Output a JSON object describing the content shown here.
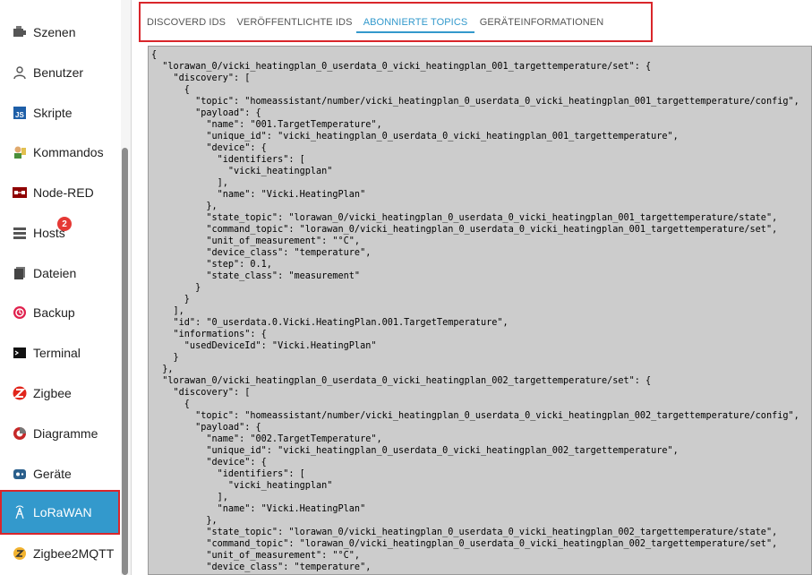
{
  "sidebar": {
    "items": [
      {
        "label": "Szenen",
        "icon": "scenes-icon"
      },
      {
        "label": "Benutzer",
        "icon": "user-icon"
      },
      {
        "label": "Skripte",
        "icon": "javascript-icon"
      },
      {
        "label": "Kommandos",
        "icon": "commands-icon"
      },
      {
        "label": "Node-RED",
        "icon": "node-red-icon"
      },
      {
        "label": "Hosts",
        "icon": "hosts-icon",
        "badge": "2"
      },
      {
        "label": "Dateien",
        "icon": "files-icon"
      },
      {
        "label": "Backup",
        "icon": "backup-icon"
      },
      {
        "label": "Terminal",
        "icon": "terminal-icon"
      },
      {
        "label": "Zigbee",
        "icon": "zigbee-icon"
      },
      {
        "label": "Diagramme",
        "icon": "diagrams-icon"
      },
      {
        "label": "Geräte",
        "icon": "devices-icon"
      },
      {
        "label": "LoRaWAN",
        "icon": "lorawan-icon",
        "active": true
      },
      {
        "label": "Zigbee2MQTT",
        "icon": "zigbee2mqtt-icon"
      }
    ]
  },
  "tabs": [
    {
      "label": "DISCOVERD IDS"
    },
    {
      "label": "VERÖFFENTLICHTE IDS"
    },
    {
      "label": "ABONNIERTE TOPICS",
      "active": true
    },
    {
      "label": "GERÄTEINFORMATIONEN"
    }
  ],
  "code": {
    "lines": [
      "{",
      "  \"lorawan_0/vicki_heatingplan_0_userdata_0_vicki_heatingplan_001_targettemperature/set\": {",
      "    \"discovery\": [",
      "      {",
      "        \"topic\": \"homeassistant/number/vicki_heatingplan_0_userdata_0_vicki_heatingplan_001_targettemperature/config\",",
      "        \"payload\": {",
      "          \"name\": \"001.TargetTemperature\",",
      "          \"unique_id\": \"vicki_heatingplan_0_userdata_0_vicki_heatingplan_001_targettemperature\",",
      "          \"device\": {",
      "            \"identifiers\": [",
      "              \"vicki_heatingplan\"",
      "            ],",
      "            \"name\": \"Vicki.HeatingPlan\"",
      "          },",
      "          \"state_topic\": \"lorawan_0/vicki_heatingplan_0_userdata_0_vicki_heatingplan_001_targettemperature/state\",",
      "          \"command_topic\": \"lorawan_0/vicki_heatingplan_0_userdata_0_vicki_heatingplan_001_targettemperature/set\",",
      "          \"unit_of_measurement\": \"°C\",",
      "          \"device_class\": \"temperature\",",
      "          \"step\": 0.1,",
      "          \"state_class\": \"measurement\"",
      "        }",
      "      }",
      "    ],",
      "    \"id\": \"0_userdata.0.Vicki.HeatingPlan.001.TargetTemperature\",",
      "    \"informations\": {",
      "      \"usedDeviceId\": \"Vicki.HeatingPlan\"",
      "    }",
      "  },",
      "  \"lorawan_0/vicki_heatingplan_0_userdata_0_vicki_heatingplan_002_targettemperature/set\": {",
      "    \"discovery\": [",
      "      {",
      "        \"topic\": \"homeassistant/number/vicki_heatingplan_0_userdata_0_vicki_heatingplan_002_targettemperature/config\",",
      "        \"payload\": {",
      "          \"name\": \"002.TargetTemperature\",",
      "          \"unique_id\": \"vicki_heatingplan_0_userdata_0_vicki_heatingplan_002_targettemperature\",",
      "          \"device\": {",
      "            \"identifiers\": [",
      "              \"vicki_heatingplan\"",
      "            ],",
      "            \"name\": \"Vicki.HeatingPlan\"",
      "          },",
      "          \"state_topic\": \"lorawan_0/vicki_heatingplan_0_userdata_0_vicki_heatingplan_002_targettemperature/state\",",
      "          \"command_topic\": \"lorawan_0/vicki_heatingplan_0_userdata_0_vicki_heatingplan_002_targettemperature/set\",",
      "          \"unit_of_measurement\": \"°C\",",
      "          \"device_class\": \"temperature\","
    ]
  },
  "colors": {
    "accent": "#3399cc",
    "highlight_border": "#d9262b",
    "badge": "#e53935",
    "code_background": "#cccccc"
  }
}
